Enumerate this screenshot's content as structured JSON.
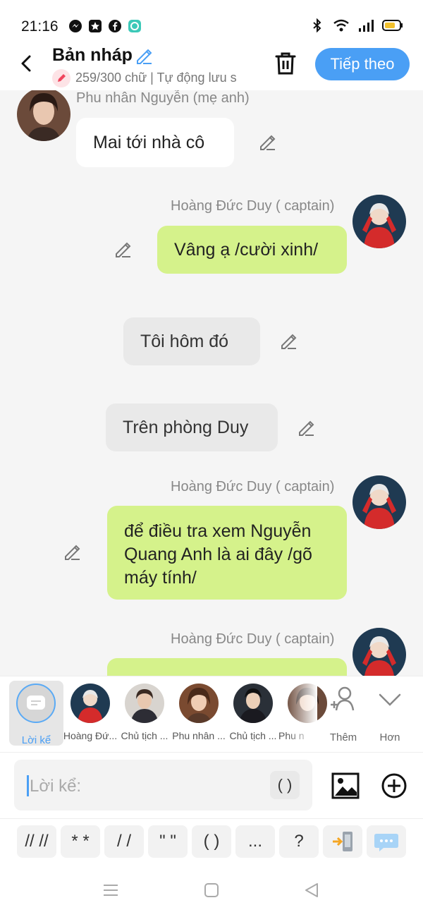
{
  "status_bar": {
    "time": "21:16"
  },
  "header": {
    "title": "Bản nháp",
    "subtitle": "259/300 chữ | Tự động lưu s",
    "next_button": "Tiếp theo"
  },
  "messages": [
    {
      "sender": "Phu nhân Nguyễn (mẹ anh)",
      "text": "Mai tới nhà cô",
      "side": "left"
    },
    {
      "sender": "Hoàng Đức Duy ( captain)",
      "text": "Vâng ạ /cười xinh/",
      "side": "right"
    },
    {
      "sender": "",
      "text": "Tôi hôm đó",
      "side": "narration"
    },
    {
      "sender": "",
      "text": "Trên phòng Duy",
      "side": "narration"
    },
    {
      "sender": "Hoàng Đức Duy ( captain)",
      "text": "để điều tra xem Nguyễn Quang Anh là ai đây /gõ máy tính/",
      "side": "right"
    },
    {
      "sender": "Hoàng Đức Duy ( captain)",
      "text": "",
      "side": "right"
    }
  ],
  "character_bar": {
    "narration_label": "Lời kể",
    "characters": [
      "Hoàng Đứ...",
      "Chủ tịch ...",
      "Phu nhân ...",
      "Chủ tịch ...",
      "Phu n"
    ],
    "add_label": "Thêm",
    "more_label": "Hơn"
  },
  "input": {
    "placeholder": "Lời kể:",
    "paren_button": "( )"
  },
  "quick_keys": [
    "// //",
    "* *",
    "/ /",
    "\" \"",
    "( )",
    "...",
    "?"
  ],
  "colors": {
    "accent": "#4a9ff5",
    "own_bubble": "#d5f28b",
    "other_bubble": "#ffffff",
    "narration_bubble": "#e9e9e9"
  }
}
